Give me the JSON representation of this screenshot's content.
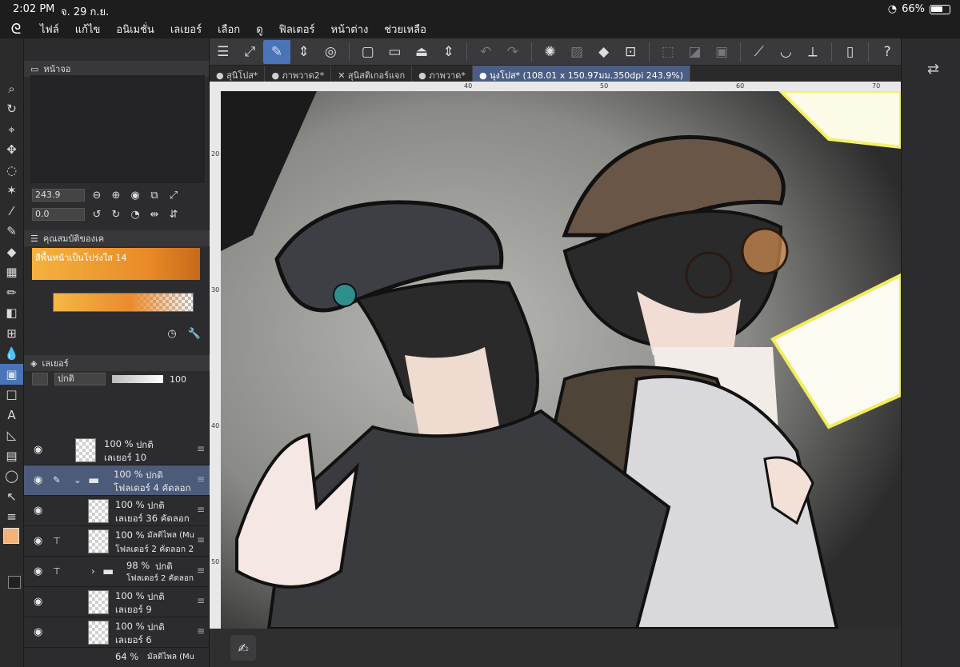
{
  "status": {
    "time": "2:02 PM",
    "date": "จ. 29 ก.ย.",
    "battery": "66%",
    "wifi": "wifi-icon"
  },
  "menu": [
    "ไฟล์",
    "แก้ไข",
    "อนิเมชั่น",
    "เลเยอร์",
    "เลือก",
    "ดู",
    "ฟิลเตอร์",
    "หน้าต่าง",
    "ช่วยเหลือ"
  ],
  "panels": {
    "navigator_title": "หน้าจอ",
    "zoom_value": "243.9",
    "rotate_value": "0.0",
    "subtool_title": "คุณสมบัติของเค",
    "gradient_name": "สีพื้นหน้าเป็นโปร่งใส 14",
    "layer_title": "เลเยอร์",
    "blend_mode": "ปกติ",
    "opacity": "100"
  },
  "layers": [
    {
      "pct": "100 %",
      "mode": "ปกติ",
      "name": "เลเยอร์ 10",
      "selected": false,
      "folder": false,
      "indent": 0
    },
    {
      "pct": "100 %",
      "mode": "ปกติ",
      "name": "โฟลเดอร์ 4 คัดลอก",
      "selected": true,
      "folder": true,
      "indent": 0
    },
    {
      "pct": "100 %",
      "mode": "ปกติ",
      "name": "เลเยอร์ 36 คัดลอก",
      "selected": false,
      "folder": false,
      "indent": 1
    },
    {
      "pct": "100 %",
      "mode": "มัลติไพล (Mu",
      "name": "โฟลเดอร์ 2 คัดลอก 2",
      "selected": false,
      "folder": false,
      "indent": 1
    },
    {
      "pct": "98 %",
      "mode": "ปกติ",
      "name": "โฟลเดอร์ 2 คัดลอก",
      "selected": false,
      "folder": true,
      "indent": 1
    },
    {
      "pct": "100 %",
      "mode": "ปกติ",
      "name": "เลเยอร์ 9",
      "selected": false,
      "folder": false,
      "indent": 1
    },
    {
      "pct": "100 %",
      "mode": "ปกติ",
      "name": "เลเยอร์ 6",
      "selected": false,
      "folder": false,
      "indent": 1
    },
    {
      "pct": "64 %",
      "mode": "มัลติไพล (Mu",
      "name": "",
      "selected": false,
      "folder": false,
      "indent": 1
    }
  ],
  "tabs": [
    "● สุนิโปส*",
    "● ภาพวาด2*",
    "✕ สุนิสติเกอร์แจก",
    "● ภาพวาด*",
    "● นุงโปส* (108.01 x 150.97มม.350dpi 243.9%)"
  ],
  "ruler": {
    "h": [
      "40",
      "50",
      "60",
      "70"
    ],
    "v": [
      "20",
      "30",
      "40",
      "50"
    ]
  }
}
